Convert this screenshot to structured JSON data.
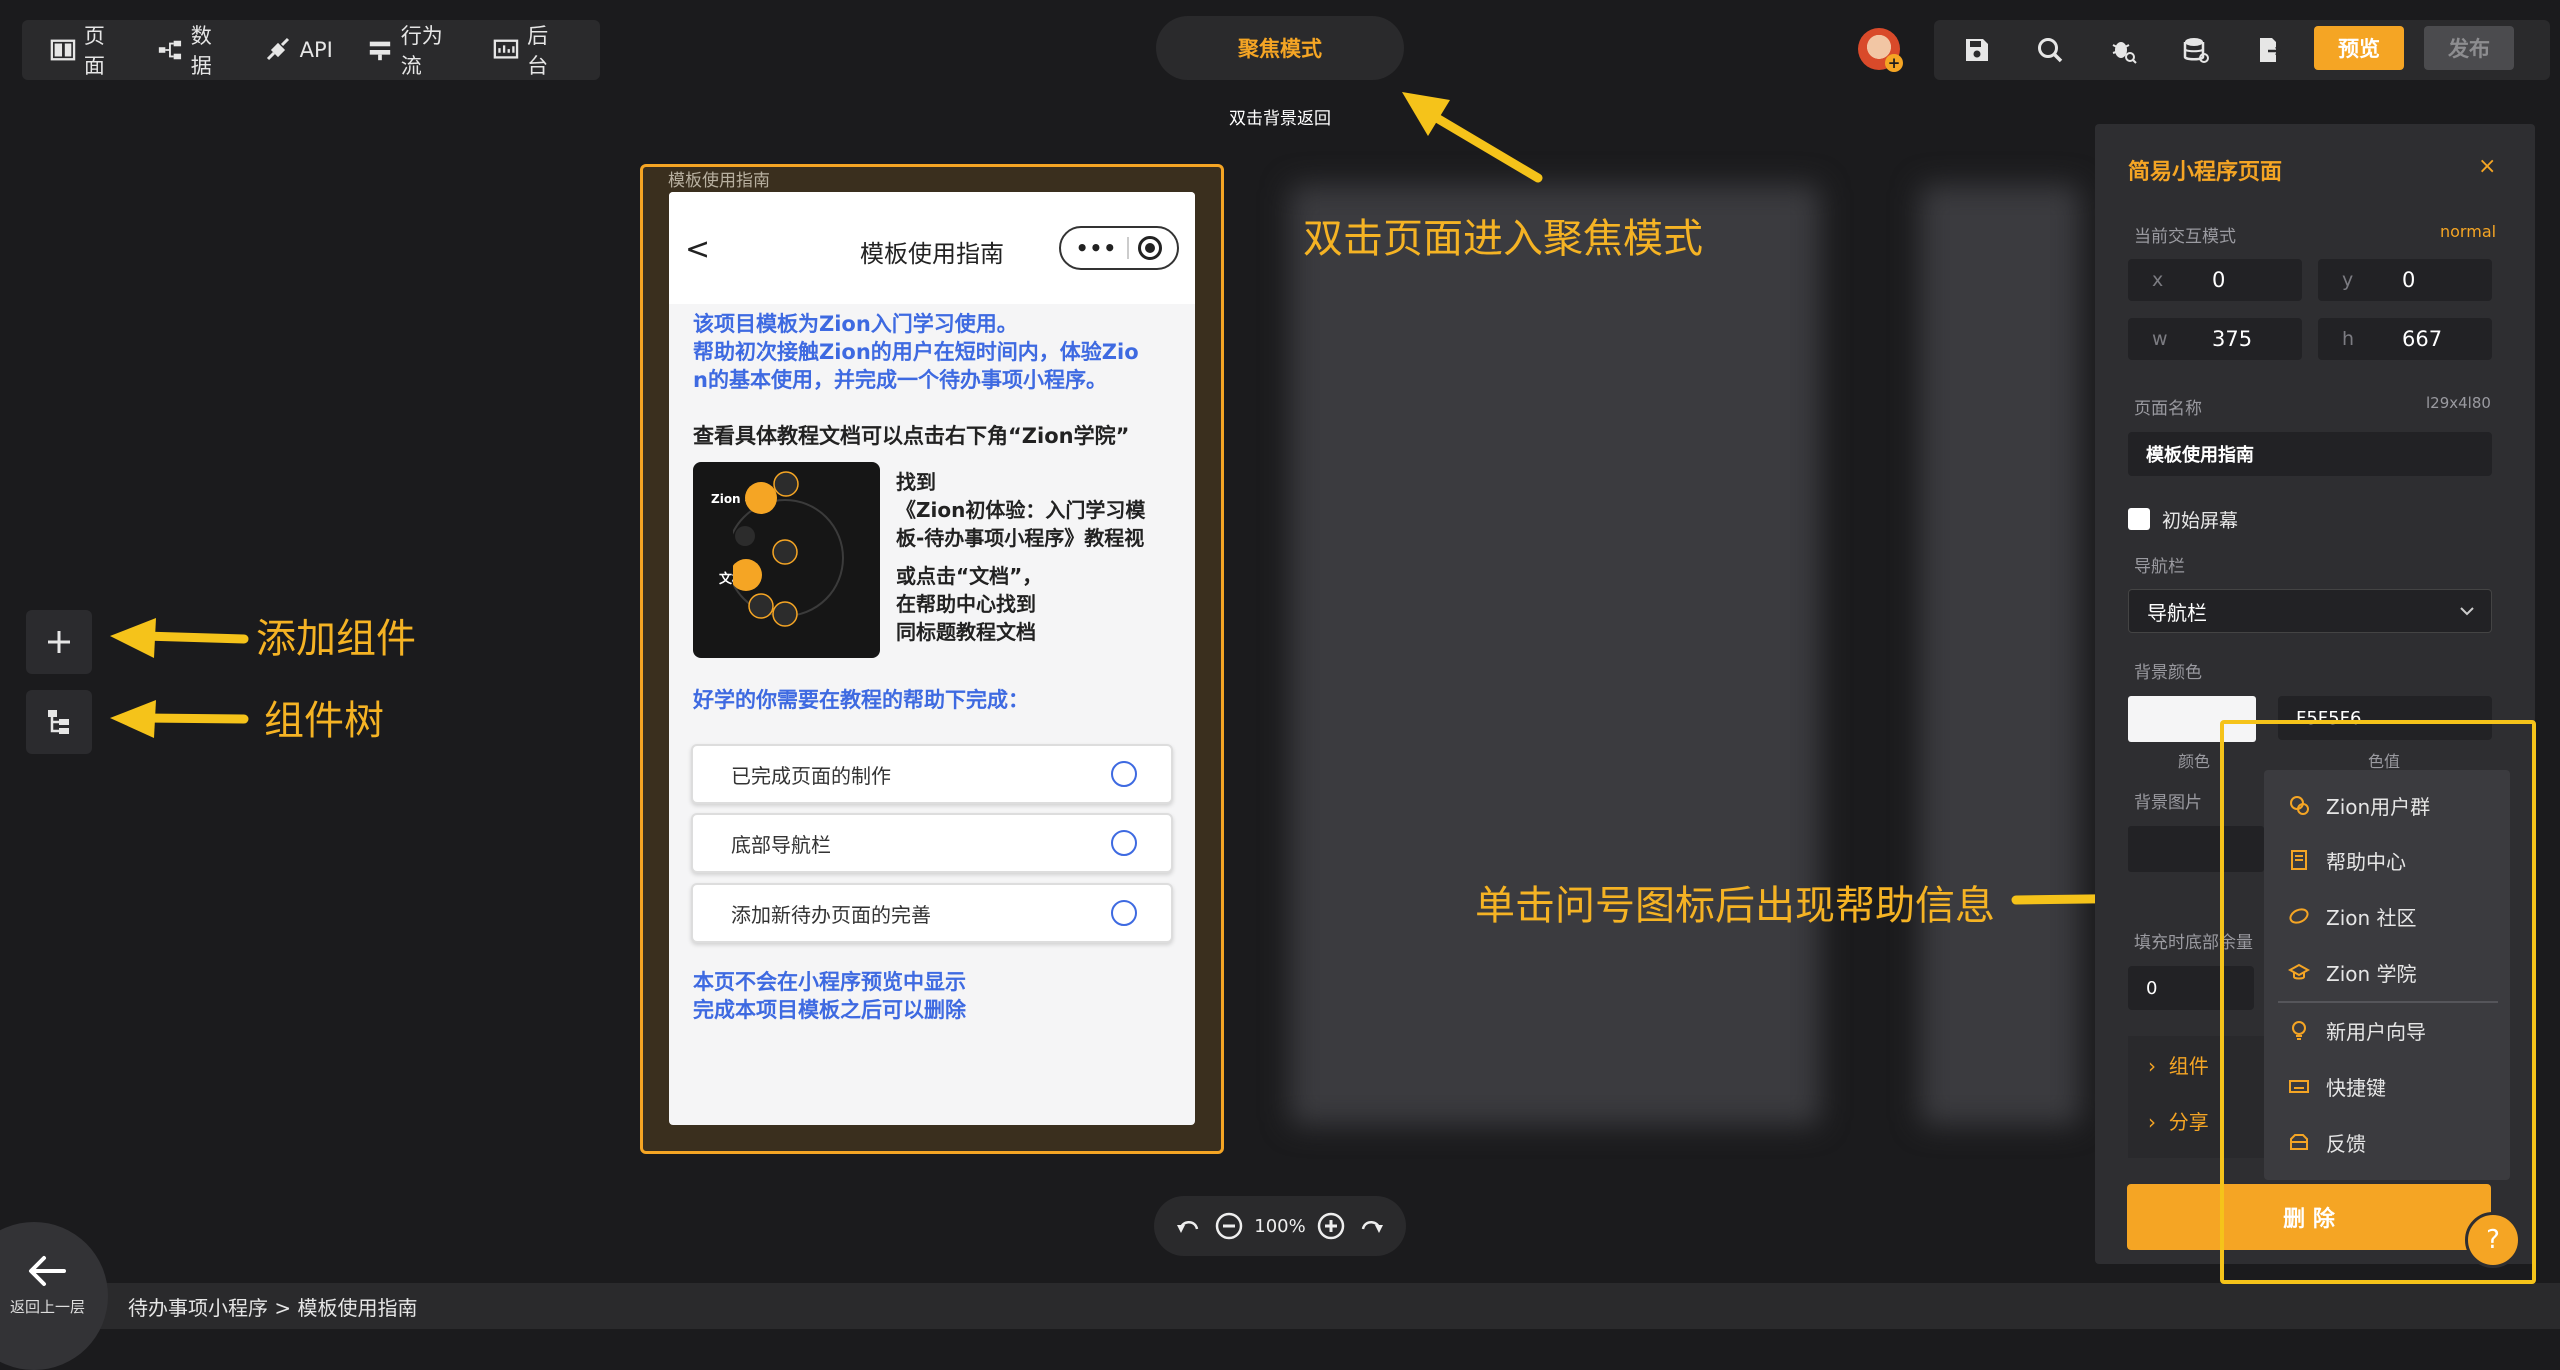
{
  "topnav": {
    "items": [
      {
        "label": "页面",
        "icon": "page-icon"
      },
      {
        "label": "数据",
        "icon": "data-icon"
      },
      {
        "label": "API",
        "icon": "api-icon"
      },
      {
        "label": "行为流",
        "icon": "flow-icon"
      },
      {
        "label": "后台",
        "icon": "backend-icon"
      }
    ]
  },
  "focus": {
    "label": "聚焦模式",
    "hint": "双击背景返回"
  },
  "toolbar": {
    "preview": "预览",
    "publish": "发布"
  },
  "annotations": {
    "focus": "双击页面进入聚焦模式",
    "add": "添加组件",
    "tree": "组件树",
    "help": "单击问号图标后出现帮助信息"
  },
  "phone": {
    "frame_label": "模板使用指南",
    "back": "<",
    "title": "模板使用指南",
    "capsule_dots": "•••",
    "intro_lines": [
      "该项目模板为Zion入门学习使用。",
      "帮助初次接触Zion的用户在短时间内，体验Zio",
      "n的基本使用，并完成一个待办事项小程序。"
    ],
    "tutorial_hint": "查看具体教程文档可以点击右下角“Zion学院”",
    "thumb": {
      "tag1": "Zion 学院",
      "tag2": "文档"
    },
    "find_lines": [
      "找到",
      "《Zion初体验：入门学习模",
      "板-待办事项小程序》教程视"
    ],
    "or_lines": [
      "或点击“文档”，",
      "在帮助中心找到",
      "同标题教程文档"
    ],
    "task_heading": "好学的你需要在教程的帮助下完成：",
    "tasks": [
      "已完成页面的制作",
      "底部导航栏",
      "添加新待办页面的完善"
    ],
    "footer_lines": [
      "本页不会在小程序预览中显示",
      "完成本项目模板之后可以删除"
    ]
  },
  "zoom": {
    "level": "100%"
  },
  "bottom": {
    "back_label": "返回上一层",
    "breadcrumb": "待办事项小程序 > 模板使用指南"
  },
  "panel": {
    "title": "简易小程序页面",
    "close": "×",
    "mode_label": "当前交互模式",
    "mode_value": "normal",
    "x_label": "x",
    "x": "0",
    "y_label": "y",
    "y": "0",
    "w_label": "w",
    "w": "375",
    "h_label": "h",
    "h": "667",
    "name_label": "页面名称",
    "name_hint": "l29x4l80",
    "name_value": "模板使用指南",
    "initial_screen": "初始屏幕",
    "navbar_label": "导航栏",
    "navbar_value": "导航栏",
    "bg_color_label": "背景颜色",
    "color_sub": "颜色",
    "value_sub": "色值",
    "bg_color_hex": "F5F5F6",
    "bg_image_label": "背景图片",
    "bottom_fill_label": "填充时底部余量",
    "bottom_fill_value": "0",
    "group1": "组件",
    "group2": "分享",
    "delete": "删 除",
    "help": "?"
  },
  "help_menu": {
    "items": [
      {
        "label": "Zion用户群",
        "icon": "user-group-icon"
      },
      {
        "label": "帮助中心",
        "icon": "help-center-icon"
      },
      {
        "label": "Zion 社区",
        "icon": "community-icon"
      },
      {
        "label": "Zion 学院",
        "icon": "academy-icon"
      },
      {
        "label": "新用户向导",
        "icon": "lightbulb-icon"
      },
      {
        "label": "快捷键",
        "icon": "keyboard-icon"
      },
      {
        "label": "反馈",
        "icon": "feedback-icon"
      }
    ]
  },
  "colors": {
    "accent": "#f5a524",
    "link_blue": "#3e6ae1",
    "callout": "#f5b324"
  }
}
